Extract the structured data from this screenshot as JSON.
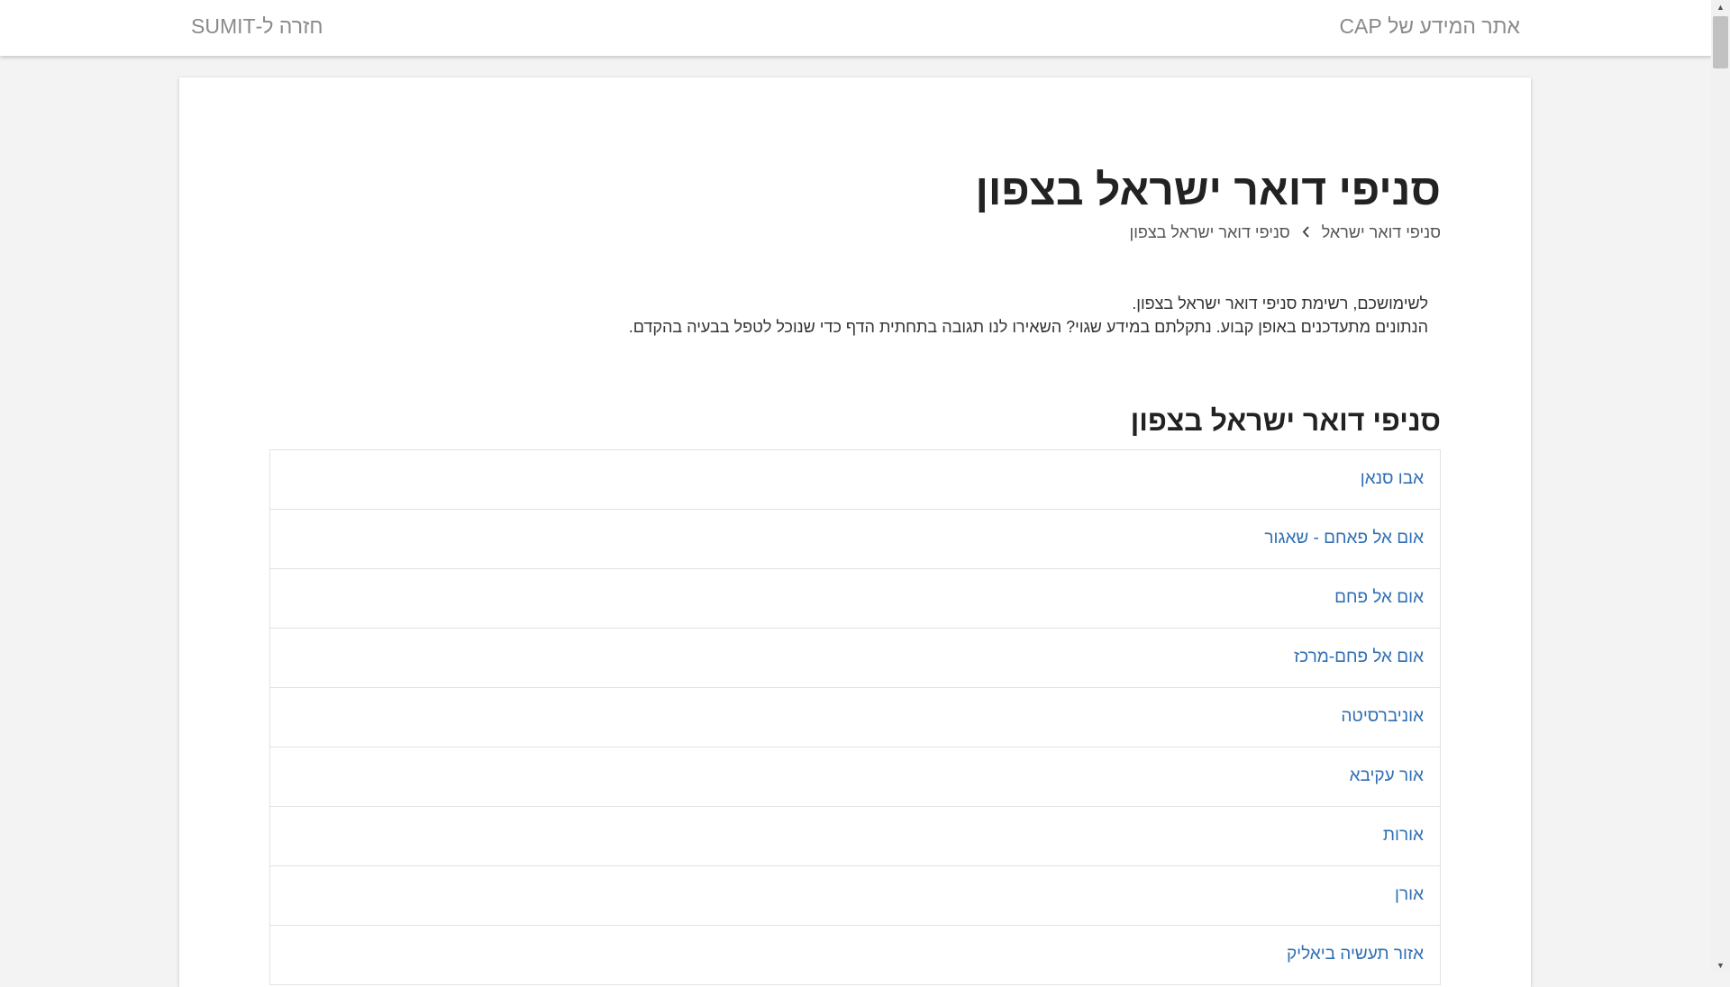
{
  "header": {
    "site_link": "אתר המידע של CAP",
    "back_link": "חזרה ל-SUMIT"
  },
  "page": {
    "title": "סניפי דואר ישראל בצפון",
    "breadcrumb": {
      "parent": "סניפי דואר ישראל",
      "separator_icon": "chevron-left-icon",
      "current": "סניפי דואר ישראל בצפון"
    },
    "intro": {
      "line1": "לשימושכם, רשימת סניפי דואר ישראל בצפון.",
      "line2": "הנתונים מתעדכנים באופן קבוע. נתקלתם במידע שגוי? השאירו לנו תגובה בתחתית הדף כדי שנוכל לטפל בבעיה בהקדם."
    },
    "section_title": "סניפי דואר ישראל בצפון",
    "branches": [
      "אבו סנאן",
      "אום אל פאחם - שאגור",
      "אום אל פחם",
      "אום אל פחם-מרכז",
      "אוניברסיטה",
      "אור עקיבא",
      "אורות",
      "אורן",
      "אזור תעשיה ביאליק"
    ]
  },
  "colors": {
    "link": "#2f6fb4",
    "page_background": "#f3f3f3",
    "card_background": "#ffffff"
  }
}
